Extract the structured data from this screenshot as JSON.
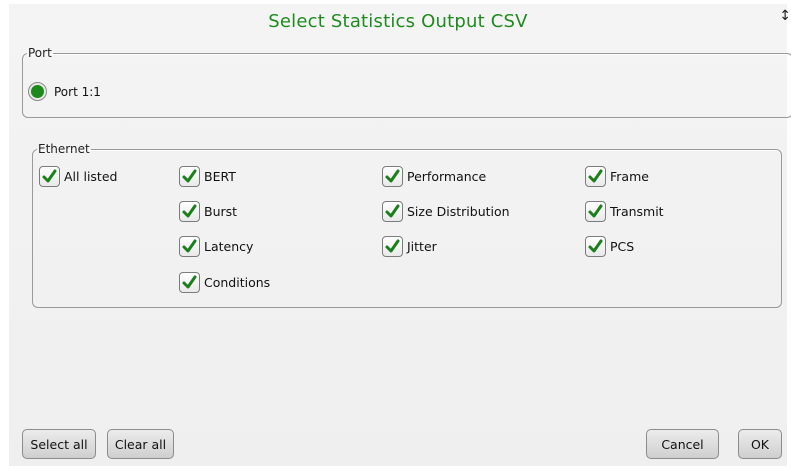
{
  "dialog": {
    "title": "Select Statistics Output CSV"
  },
  "port_group": {
    "legend": "Port",
    "radio_label": "Port 1:1",
    "selected": true
  },
  "ethernet_group": {
    "legend": "Ethernet",
    "checkboxes": [
      {
        "label": "All listed",
        "checked": true
      },
      {
        "label": "BERT",
        "checked": true
      },
      {
        "label": "Burst",
        "checked": true
      },
      {
        "label": "Latency",
        "checked": true
      },
      {
        "label": "Conditions",
        "checked": true
      },
      {
        "label": "Performance",
        "checked": true
      },
      {
        "label": "Size Distribution",
        "checked": true
      },
      {
        "label": "Jitter",
        "checked": true
      },
      {
        "label": "Frame",
        "checked": true
      },
      {
        "label": "Transmit",
        "checked": true
      },
      {
        "label": "PCS",
        "checked": true
      }
    ]
  },
  "buttons": {
    "select_all": "Select all",
    "clear_all": "Clear all",
    "cancel": "Cancel",
    "ok": "OK"
  },
  "colors": {
    "accent": "#1f8a1f",
    "check": "#1b7f1b",
    "panel": "#f1f1f1"
  },
  "icons": {
    "check": "checkmark-icon",
    "radio": "radio-selected-icon"
  }
}
